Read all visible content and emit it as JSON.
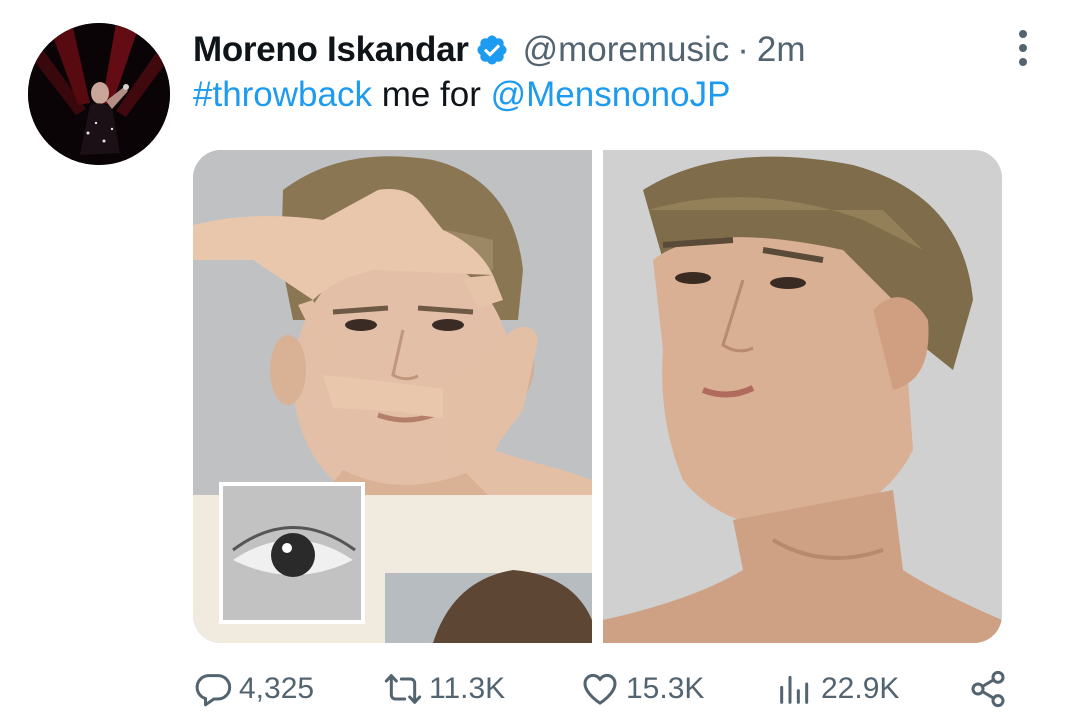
{
  "tweet": {
    "display_name": "Moreno Iskandar",
    "handle": "@moremusic",
    "separator": "·",
    "time": "2m",
    "text": {
      "hashtag": "#throwback",
      "middle": " me for ",
      "mention": "@MensnonoJP"
    }
  },
  "actions": {
    "replies": "4,325",
    "retweets": "11.3K",
    "likes": "15.3K",
    "views": "22.9K"
  },
  "colors": {
    "link": "#1d9bf0",
    "verified": "#1d9bf0",
    "secondary_text": "#536471",
    "primary_text": "#0f1419"
  },
  "icons": {
    "verified": "verified-badge-icon",
    "more": "more-vertical-icon",
    "reply": "reply-icon",
    "retweet": "retweet-icon",
    "like": "heart-icon",
    "views": "views-chart-icon",
    "share": "share-icon"
  }
}
